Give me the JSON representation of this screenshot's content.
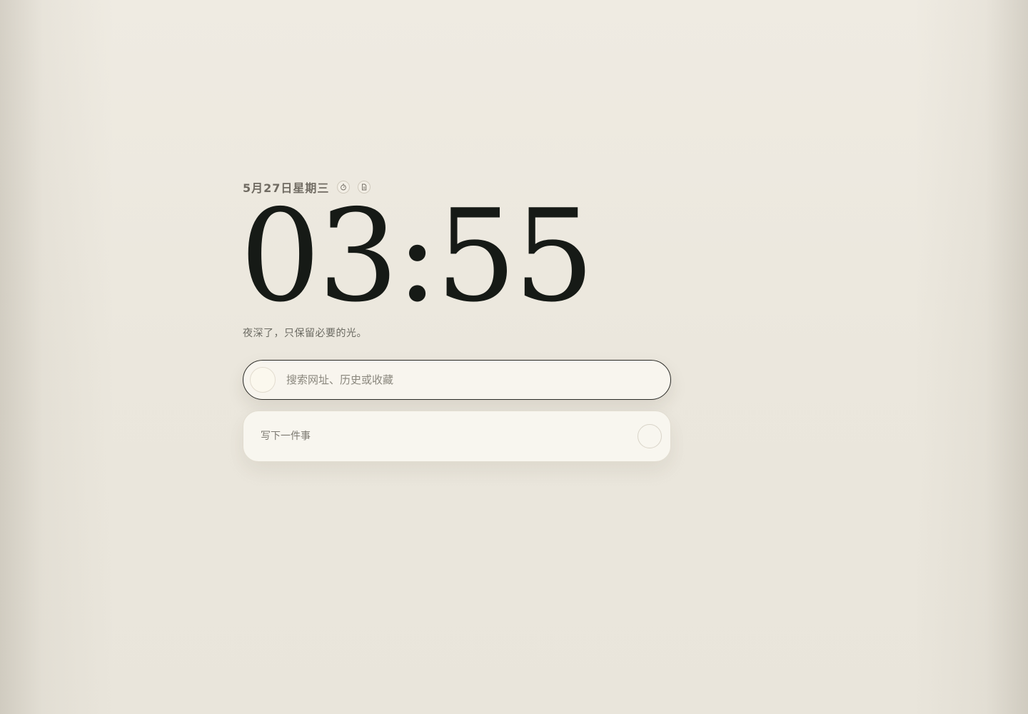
{
  "header": {
    "date": "5月27日星期三",
    "icons": [
      "timer-icon",
      "document-icon"
    ]
  },
  "clock": {
    "time": "03:55"
  },
  "greeting": {
    "text": "夜深了，只保留必要的光。"
  },
  "search": {
    "placeholder": "搜索网址、历史或收藏",
    "value": ""
  },
  "todo": {
    "placeholder": "写下一件事",
    "value": ""
  },
  "colors": {
    "background": "#ece8df",
    "clock_text": "#161a16",
    "muted_text": "#706b62",
    "search_border": "#2a2a26",
    "panel": "#f8f5ee"
  }
}
